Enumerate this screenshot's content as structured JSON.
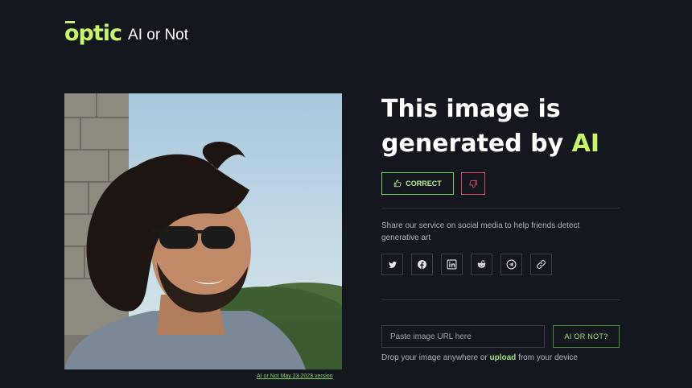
{
  "header": {
    "logo_text": "optic",
    "app_name": "AI or Not"
  },
  "image_panel": {
    "caption": "AI or Not May 23 2023 version"
  },
  "result": {
    "headline_prefix": "This image is generated by ",
    "headline_highlight": "AI"
  },
  "feedback": {
    "correct_label": "CORRECT",
    "correct_icon": "thumbs-up-icon",
    "wrong_icon": "thumbs-down-icon"
  },
  "share": {
    "text": "Share our service on social media to help friends detect generative art",
    "icons": [
      "twitter-icon",
      "facebook-icon",
      "linkedin-icon",
      "reddit-icon",
      "telegram-icon",
      "link-icon"
    ]
  },
  "upload": {
    "url_placeholder": "Paste image URL here",
    "submit_label": "AI OR NOT?",
    "drop_prefix": "Drop your image anywhere or ",
    "drop_link": "upload",
    "drop_suffix": " from your device"
  },
  "colors": {
    "background": "#14171e",
    "accent": "#c6f56b",
    "correct_border": "#6fd155",
    "wrong_border": "#d94a6a"
  }
}
